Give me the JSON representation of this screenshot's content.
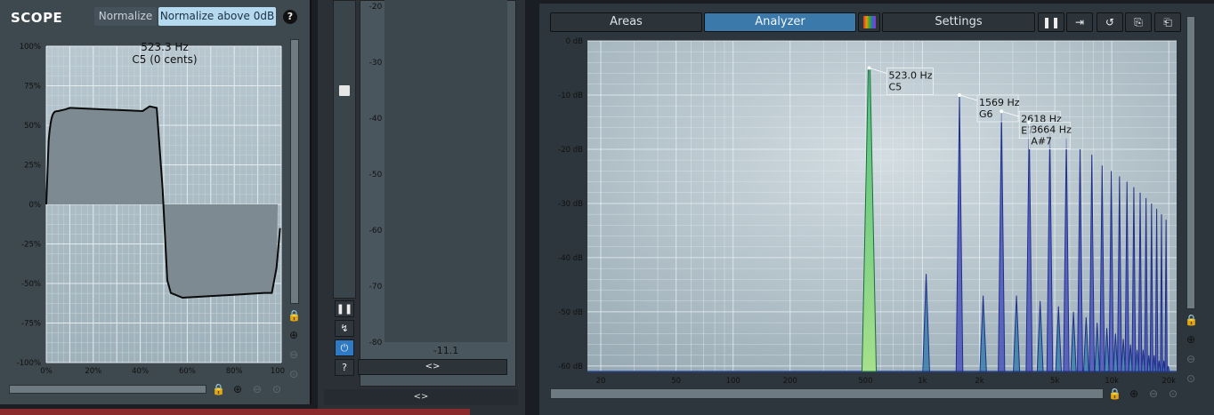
{
  "scope": {
    "title": "SCOPE",
    "normalize_label": "Normalize",
    "normalize_above_label": "Normalize above 0dB",
    "help_label": "?",
    "readout_freq": "523.3 Hz",
    "readout_note": "C5 (0 cents)",
    "y_ticks": [
      "100%",
      "75%",
      "50%",
      "25%",
      "0%",
      "-25%",
      "-50%",
      "-75%",
      "-100%"
    ],
    "x_ticks": [
      "0%",
      "20%",
      "40%",
      "60%",
      "80%",
      "100%"
    ]
  },
  "meter": {
    "ticks": [
      "-20",
      "-30",
      "-40",
      "-50",
      "-60",
      "-70",
      "-80"
    ],
    "value": "-11.1",
    "expand_label": "<>",
    "mid_expand_label": "<>",
    "help_label": "?"
  },
  "analyzer": {
    "tabs": [
      "Areas",
      "Analyzer",
      "Settings"
    ],
    "y_ticks": [
      "0 dB",
      "-10 dB",
      "-20 dB",
      "-30 dB",
      "-40 dB",
      "-50 dB",
      "-60 dB"
    ],
    "x_ticks": [
      "20",
      "50",
      "100",
      "200",
      "500",
      "1k",
      "2k",
      "5k",
      "10k",
      "20k"
    ],
    "peaks": [
      {
        "freq": "523.0 Hz",
        "note": "C5"
      },
      {
        "freq": "1569 Hz",
        "note": "G6"
      },
      {
        "freq": "2618 Hz",
        "note": "E7"
      },
      {
        "freq": "3664 Hz",
        "note": "A#7"
      }
    ],
    "spectrum": {
      "fundamental_hz": 523,
      "fundamental_db": -5,
      "harmonic_db": [
        -5,
        -43,
        -10,
        -47,
        -13,
        -47,
        -15,
        -48,
        -17,
        -49,
        -18,
        -50,
        -20,
        -51,
        -21,
        -52,
        -23,
        -53,
        -24,
        -54,
        -25,
        -55,
        -26,
        -56,
        -27,
        -57,
        -28,
        -57,
        -29,
        -58,
        -30,
        -58,
        -31,
        -59,
        -32,
        -59,
        -33,
        -60
      ]
    },
    "accent_color": "#3b79ab"
  }
}
